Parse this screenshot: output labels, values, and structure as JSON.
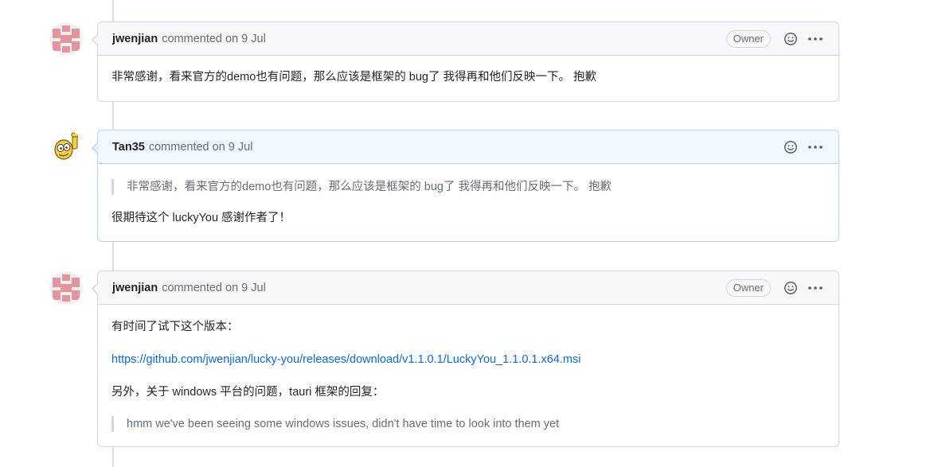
{
  "comments": [
    {
      "author": "jwenjian",
      "meta": "commented on 9 Jul",
      "badge": "Owner",
      "avatar": "identicon-avatar",
      "body": {
        "p1": "非常感谢，看来官方的demo也有问题，那么应该是框架的 bug了 我得再和他们反映一下。 抱歉"
      }
    },
    {
      "author": "Tan35",
      "meta": "commented on 9 Jul",
      "avatar": "cartoon-avatar",
      "body": {
        "quote": "非常感谢，看来官方的demo也有问题，那么应该是框架的 bug了 我得再和他们反映一下。 抱歉",
        "p1": "很期待这个 luckyYou 感谢作者了！"
      }
    },
    {
      "author": "jwenjian",
      "meta": "commented on 9 Jul",
      "badge": "Owner",
      "avatar": "identicon-avatar",
      "body": {
        "p1": "有时间了试下这个版本：",
        "link": "https://github.com/jwenjian/lucky-you/releases/download/v1.1.0.1/LuckyYou_1.1.0.1.x64.msi",
        "p2": "另外，关于 windows 平台的问题，tauri 框架的回复：",
        "quote": "hmm we've been seeing some windows issues, didn't have time to look into them yet"
      }
    }
  ],
  "icons": {
    "reaction": "smiley-icon",
    "more": "kebab-menu-icon"
  },
  "colors": {
    "link": "#0969da",
    "muted": "#656d76",
    "border": "#d0d7de",
    "highlight_header": "#f1f8ff",
    "avatar_pink": "#e8a0a7"
  }
}
